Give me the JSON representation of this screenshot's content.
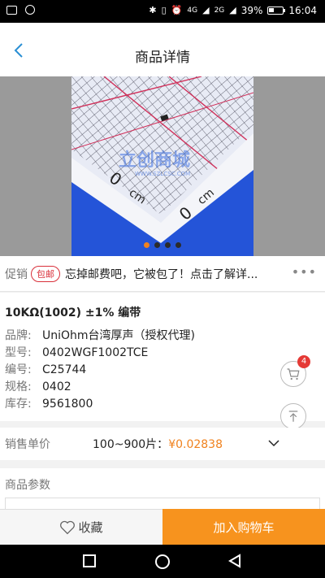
{
  "status_bar": {
    "battery": "39%",
    "time": "16:04",
    "signal_4g": "4G",
    "signal_2g": "2G",
    "battery_level": 0.39
  },
  "header": {
    "title": "商品详情"
  },
  "gallery": {
    "watermark": "立创商城",
    "watermark_url": "WWW.SZLCSC.COM",
    "ruler_label": "cm",
    "ruler_digit": "0",
    "dot_count": 4,
    "active_dot": 0
  },
  "promo": {
    "label": "促销",
    "badge": "包邮",
    "text": "忘掉邮费吧，它被包了！点击了解详...",
    "more": "•••"
  },
  "product": {
    "name": "10KΩ(1002) ±1% 编带",
    "fields": [
      {
        "k": "品牌:",
        "v": "UniOhm台湾厚声（授权代理)"
      },
      {
        "k": "型号:",
        "v": "0402WGF1002TCE"
      },
      {
        "k": "编号:",
        "v": "C25744"
      },
      {
        "k": "规格:",
        "v": "0402"
      },
      {
        "k": "库存:",
        "v": " 9561800"
      }
    ]
  },
  "cart": {
    "count": "4"
  },
  "price": {
    "label": "销售单价",
    "range": "100~900片：",
    "value": "¥0.02838"
  },
  "params": {
    "title": "商品参数"
  },
  "bottom_bar": {
    "favorite": "收藏",
    "add_to_cart": "加入购物车"
  },
  "colors": {
    "accent": "#f7931e",
    "price": "#f0821e",
    "badge_red": "#d9303a",
    "back_icon": "#2a8fd4"
  }
}
